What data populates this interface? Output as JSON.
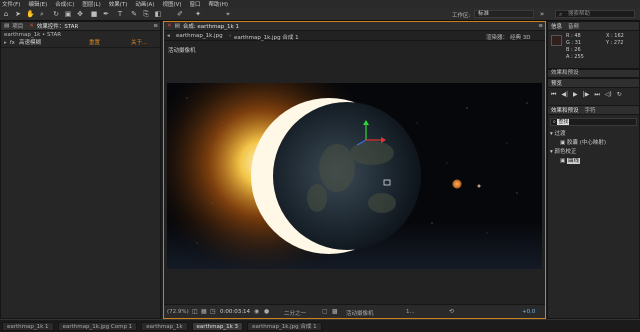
{
  "menu": [
    "文件(F)",
    "编辑(E)",
    "合成(C)",
    "图层(L)",
    "效果(T)",
    "动画(A)",
    "视图(V)",
    "窗口",
    "帮助(H)"
  ],
  "toolbar": {
    "workspace_label": "工作区:",
    "workspace_value": "标准",
    "search_placeholder": "搜索帮助"
  },
  "left_panel": {
    "tabs": [
      "项目",
      "效果控件：STAR"
    ],
    "breadcrumb": "earthmap_1k • STAR",
    "effect_name": "高速模糊",
    "reset_label": "重置",
    "about_label": "关于..."
  },
  "viewer": {
    "tab_label": "合成: earthmap_1k 1",
    "breadcrumb": [
      "earthmap_1k.jpg",
      "earthmap_1k.jpg 合成 1"
    ],
    "renderer_label": "渲染器：",
    "renderer_value": "经典 3D",
    "camera_label": "活动摄像机",
    "zoom": "(72.9%)",
    "timecode": "0:00:03:14",
    "quality": "二分之一",
    "camera_select": "活动摄像机",
    "offset": "+0.0"
  },
  "info_panel": {
    "tabs": [
      "信息",
      "音频"
    ],
    "r": "R : 48",
    "g": "G : 31",
    "b": "B : 26",
    "a": "A : 255",
    "x": "X : 162",
    "y": "Y : 272",
    "swatch_color": "#301f1a"
  },
  "preview_panel": {
    "title": "预览"
  },
  "shortcut_bar": "效果和预设",
  "text_panel": {
    "tabs": [
      "效果和预设",
      "字符"
    ],
    "search_placeholder": "查找",
    "tree": [
      {
        "label": "过渡",
        "type": "folder"
      },
      {
        "label": "胶囊 (中心映射)",
        "type": "item"
      },
      {
        "label": "颜色校正",
        "type": "folder"
      },
      {
        "label": "曲线",
        "type": "item",
        "selected": true
      }
    ]
  },
  "bottom_tabs": [
    {
      "label": "earthmap_1k 1",
      "active": false
    },
    {
      "label": "earthmap_1k.jpg Comp 1",
      "active": false
    },
    {
      "label": "earthmap_1k",
      "active": false
    },
    {
      "label": "earthmap_1k 3",
      "active": true
    },
    {
      "label": "earthmap_1k.jpg 合成 1",
      "active": false
    }
  ],
  "colors": {
    "accent": "#e08a1e",
    "viewer_border": "#c9801e",
    "background": "#1e1e1e"
  }
}
